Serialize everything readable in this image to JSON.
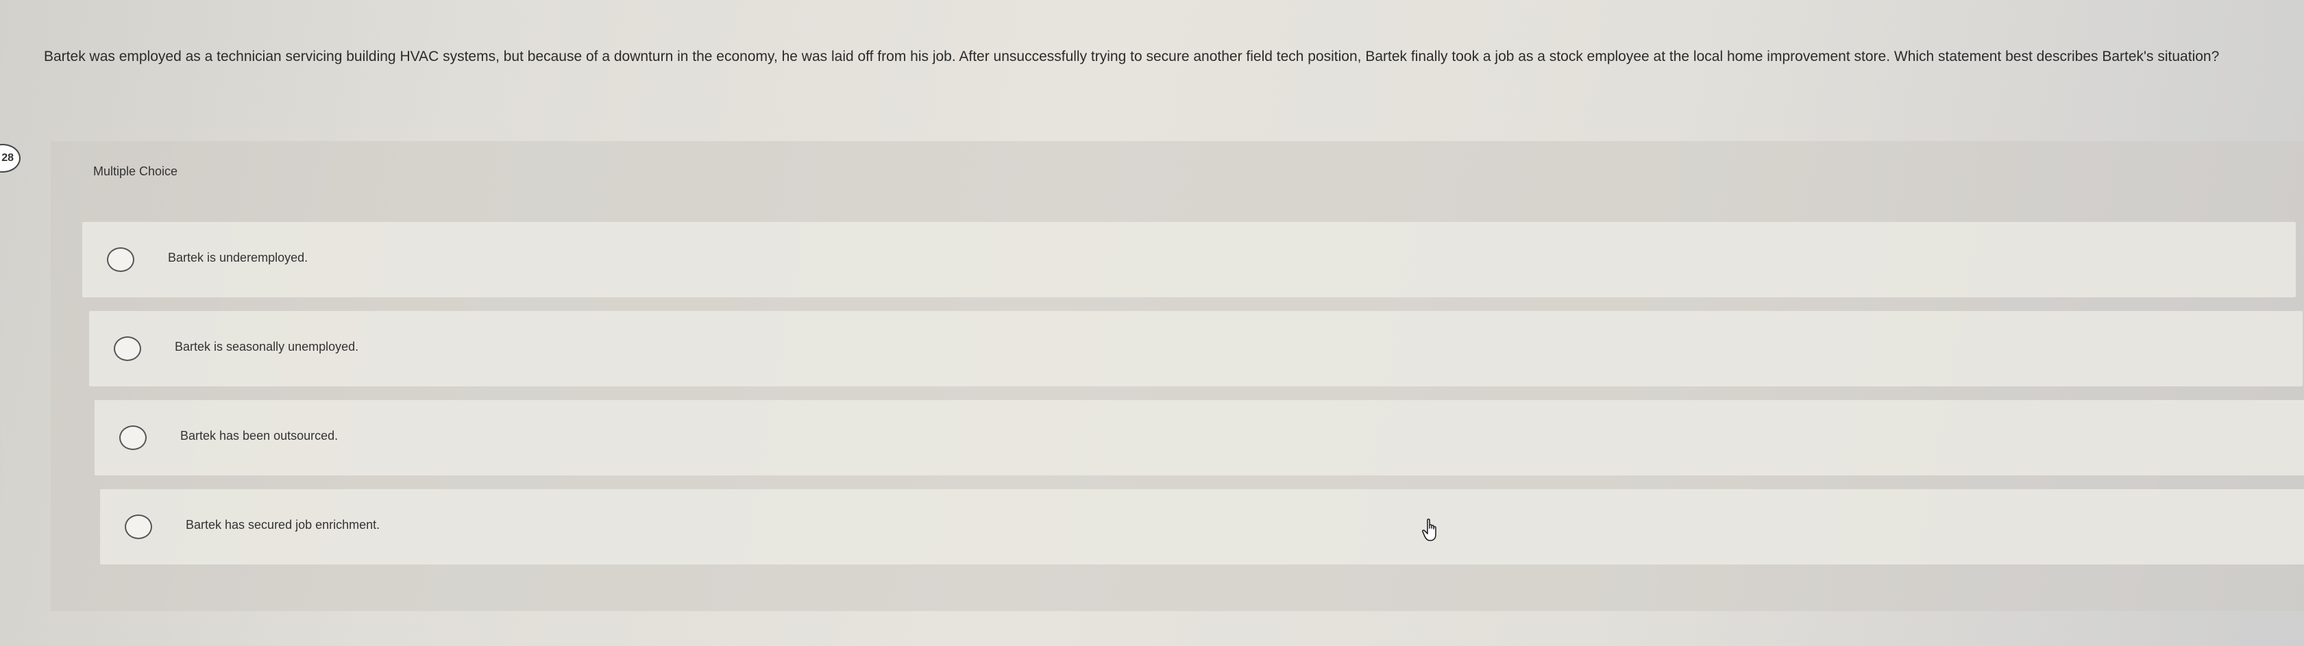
{
  "question": {
    "number": "28",
    "text": "Bartek was employed as a technician servicing building HVAC systems, but because of a downturn in the economy, he was laid off from his job. After unsuccessfully trying to secure another field tech position, Bartek finally took a job as a stock employee at the local home improvement store. Which statement best describes Bartek's situation?"
  },
  "answer_area": {
    "type_label": "Multiple Choice",
    "options": [
      {
        "label": "Bartek is underemployed."
      },
      {
        "label": "Bartek is seasonally unemployed."
      },
      {
        "label": "Bartek has been outsourced."
      },
      {
        "label": "Bartek has secured job enrichment."
      }
    ]
  },
  "cursor": {
    "icon": "hand-pointer-icon"
  },
  "colors": {
    "radio_border": "#555555",
    "text": "#2b2b2b"
  }
}
